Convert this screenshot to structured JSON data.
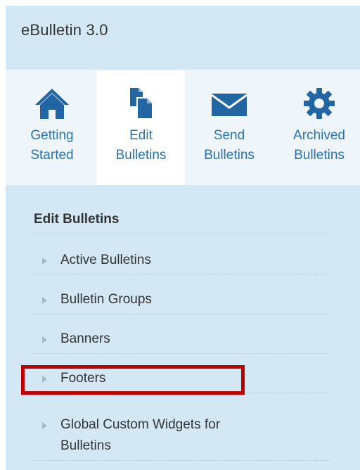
{
  "app": {
    "title": "eBulletin 3.0"
  },
  "nav": {
    "tabs": [
      {
        "line1": "Getting",
        "line2": "Started",
        "icon": "home-icon",
        "active": false
      },
      {
        "line1": "Edit",
        "line2": "Bulletins",
        "icon": "documents-icon",
        "active": true
      },
      {
        "line1": "Send",
        "line2": "Bulletins",
        "icon": "envelope-icon",
        "active": false
      },
      {
        "line1": "Archived",
        "line2": "Bulletins",
        "icon": "gear-icon",
        "active": false
      }
    ]
  },
  "menu": {
    "heading": "Edit Bulletins",
    "items": [
      {
        "label": "Active Bulletins"
      },
      {
        "label": "Bulletin Groups"
      },
      {
        "label": "Banners"
      },
      {
        "label": "Footers",
        "highlighted": true
      },
      {
        "label_line1": "Global Custom Widgets for",
        "label_line2": "Bulletins"
      }
    ]
  },
  "colors": {
    "background": "#d3e8f4",
    "nav_background": "#eef6fb",
    "icon": "#2166a3",
    "link": "#2872b3",
    "highlight": "#c00000"
  }
}
